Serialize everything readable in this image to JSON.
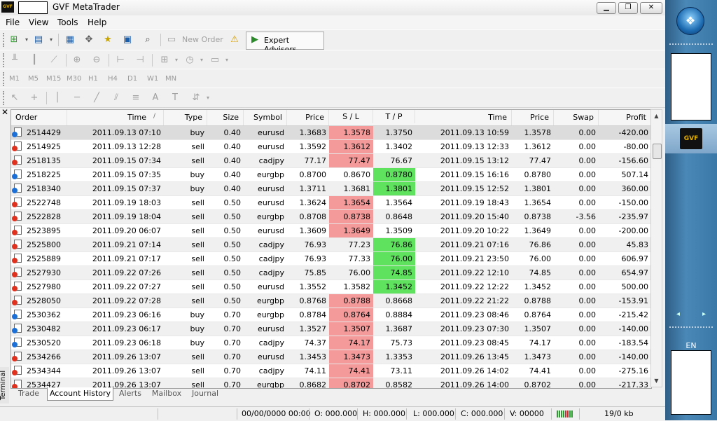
{
  "window": {
    "title": "GVF MetaTrader",
    "logo_text": "GVF"
  },
  "menu": [
    "File",
    "View",
    "Tools",
    "Help"
  ],
  "toolbar": {
    "new_order": "New Order",
    "expert_advisors": "Expert Advisors"
  },
  "timeframes": [
    "M1",
    "M5",
    "M15",
    "M30",
    "H1",
    "H4",
    "D1",
    "W1",
    "MN"
  ],
  "terminal": {
    "label": "Terminal",
    "columns": {
      "order": "Order",
      "open_time": "Time",
      "sort_indicator": "/",
      "type": "Type",
      "size": "Size",
      "symbol": "Symbol",
      "open_price": "Price",
      "sl": "S / L",
      "tp": "T / P",
      "close_time": "Time",
      "close_price": "Price",
      "swap": "Swap",
      "profit": "Profit"
    },
    "rows": [
      {
        "order": "2514429",
        "open_time": "2011.09.13 07:10",
        "type": "buy",
        "size": "0.40",
        "symbol": "eurusd",
        "open_price": "1.3683",
        "sl": "1.3578",
        "tp": "1.3750",
        "close_time": "2011.09.13 10:59",
        "close_price": "1.3578",
        "swap": "0.00",
        "profit": "-420.00",
        "hit": "sl"
      },
      {
        "order": "2514925",
        "open_time": "2011.09.13 12:28",
        "type": "sell",
        "size": "0.40",
        "symbol": "eurusd",
        "open_price": "1.3592",
        "sl": "1.3612",
        "tp": "1.3402",
        "close_time": "2011.09.13 12:33",
        "close_price": "1.3612",
        "swap": "0.00",
        "profit": "-80.00",
        "hit": "sl"
      },
      {
        "order": "2518135",
        "open_time": "2011.09.15 07:34",
        "type": "sell",
        "size": "0.40",
        "symbol": "cadjpy",
        "open_price": "77.17",
        "sl": "77.47",
        "tp": "76.67",
        "close_time": "2011.09.15 13:12",
        "close_price": "77.47",
        "swap": "0.00",
        "profit": "-156.60",
        "hit": "sl"
      },
      {
        "order": "2518225",
        "open_time": "2011.09.15 07:35",
        "type": "buy",
        "size": "0.40",
        "symbol": "eurgbp",
        "open_price": "0.8700",
        "sl": "0.8670",
        "tp": "0.8780",
        "close_time": "2011.09.15 16:16",
        "close_price": "0.8780",
        "swap": "0.00",
        "profit": "507.14",
        "hit": "tp"
      },
      {
        "order": "2518340",
        "open_time": "2011.09.15 07:37",
        "type": "buy",
        "size": "0.40",
        "symbol": "eurusd",
        "open_price": "1.3711",
        "sl": "1.3681",
        "tp": "1.3801",
        "close_time": "2011.09.15 12:52",
        "close_price": "1.3801",
        "swap": "0.00",
        "profit": "360.00",
        "hit": "tp"
      },
      {
        "order": "2522748",
        "open_time": "2011.09.19 18:03",
        "type": "sell",
        "size": "0.50",
        "symbol": "eurusd",
        "open_price": "1.3624",
        "sl": "1.3654",
        "tp": "1.3564",
        "close_time": "2011.09.19 18:43",
        "close_price": "1.3654",
        "swap": "0.00",
        "profit": "-150.00",
        "hit": "sl"
      },
      {
        "order": "2522828",
        "open_time": "2011.09.19 18:04",
        "type": "sell",
        "size": "0.50",
        "symbol": "eurgbp",
        "open_price": "0.8708",
        "sl": "0.8738",
        "tp": "0.8648",
        "close_time": "2011.09.20 15:40",
        "close_price": "0.8738",
        "swap": "-3.56",
        "profit": "-235.97",
        "hit": "sl"
      },
      {
        "order": "2523895",
        "open_time": "2011.09.20 06:07",
        "type": "sell",
        "size": "0.50",
        "symbol": "eurusd",
        "open_price": "1.3609",
        "sl": "1.3649",
        "tp": "1.3509",
        "close_time": "2011.09.20 10:22",
        "close_price": "1.3649",
        "swap": "0.00",
        "profit": "-200.00",
        "hit": "sl"
      },
      {
        "order": "2525800",
        "open_time": "2011.09.21 07:14",
        "type": "sell",
        "size": "0.50",
        "symbol": "cadjpy",
        "open_price": "76.93",
        "sl": "77.23",
        "tp": "76.86",
        "close_time": "2011.09.21 07:16",
        "close_price": "76.86",
        "swap": "0.00",
        "profit": "45.83",
        "hit": "tp"
      },
      {
        "order": "2525889",
        "open_time": "2011.09.21 07:17",
        "type": "sell",
        "size": "0.50",
        "symbol": "cadjpy",
        "open_price": "76.93",
        "sl": "77.33",
        "tp": "76.00",
        "close_time": "2011.09.21 23:50",
        "close_price": "76.00",
        "swap": "0.00",
        "profit": "606.97",
        "hit": "tp"
      },
      {
        "order": "2527930",
        "open_time": "2011.09.22 07:26",
        "type": "sell",
        "size": "0.50",
        "symbol": "cadjpy",
        "open_price": "75.85",
        "sl": "76.00",
        "tp": "74.85",
        "close_time": "2011.09.22 12:10",
        "close_price": "74.85",
        "swap": "0.00",
        "profit": "654.97",
        "hit": "tp"
      },
      {
        "order": "2527980",
        "open_time": "2011.09.22 07:27",
        "type": "sell",
        "size": "0.50",
        "symbol": "eurusd",
        "open_price": "1.3552",
        "sl": "1.3582",
        "tp": "1.3452",
        "close_time": "2011.09.22 12:22",
        "close_price": "1.3452",
        "swap": "0.00",
        "profit": "500.00",
        "hit": "tp"
      },
      {
        "order": "2528050",
        "open_time": "2011.09.22 07:28",
        "type": "sell",
        "size": "0.50",
        "symbol": "eurgbp",
        "open_price": "0.8768",
        "sl": "0.8788",
        "tp": "0.8668",
        "close_time": "2011.09.22 21:22",
        "close_price": "0.8788",
        "swap": "0.00",
        "profit": "-153.91",
        "hit": "sl"
      },
      {
        "order": "2530362",
        "open_time": "2011.09.23 06:16",
        "type": "buy",
        "size": "0.70",
        "symbol": "eurgbp",
        "open_price": "0.8784",
        "sl": "0.8764",
        "tp": "0.8884",
        "close_time": "2011.09.23 08:46",
        "close_price": "0.8764",
        "swap": "0.00",
        "profit": "-215.42",
        "hit": "sl"
      },
      {
        "order": "2530482",
        "open_time": "2011.09.23 06:17",
        "type": "buy",
        "size": "0.70",
        "symbol": "eurusd",
        "open_price": "1.3527",
        "sl": "1.3507",
        "tp": "1.3687",
        "close_time": "2011.09.23 07:30",
        "close_price": "1.3507",
        "swap": "0.00",
        "profit": "-140.00",
        "hit": "sl"
      },
      {
        "order": "2530520",
        "open_time": "2011.09.23 06:18",
        "type": "buy",
        "size": "0.70",
        "symbol": "cadjpy",
        "open_price": "74.37",
        "sl": "74.17",
        "tp": "75.73",
        "close_time": "2011.09.23 08:45",
        "close_price": "74.17",
        "swap": "0.00",
        "profit": "-183.54",
        "hit": "sl"
      },
      {
        "order": "2534266",
        "open_time": "2011.09.26 13:07",
        "type": "sell",
        "size": "0.70",
        "symbol": "eurusd",
        "open_price": "1.3453",
        "sl": "1.3473",
        "tp": "1.3353",
        "close_time": "2011.09.26 13:45",
        "close_price": "1.3473",
        "swap": "0.00",
        "profit": "-140.00",
        "hit": "sl"
      },
      {
        "order": "2534344",
        "open_time": "2011.09.26 13:07",
        "type": "sell",
        "size": "0.70",
        "symbol": "cadjpy",
        "open_price": "74.11",
        "sl": "74.41",
        "tp": "73.11",
        "close_time": "2011.09.26 14:02",
        "close_price": "74.41",
        "swap": "0.00",
        "profit": "-275.16",
        "hit": "sl"
      },
      {
        "order": "2534427",
        "open_time": "2011.09.26 13:07",
        "type": "sell",
        "size": "0.70",
        "symbol": "eurgbp",
        "open_price": "0.8682",
        "sl": "0.8702",
        "tp": "0.8582",
        "close_time": "2011.09.26 14:00",
        "close_price": "0.8702",
        "swap": "0.00",
        "profit": "-217.33",
        "hit": "sl"
      }
    ],
    "tabs": [
      "Trade",
      "Account History",
      "Alerts",
      "Mailbox",
      "Journal"
    ],
    "active_tab": "Account History"
  },
  "statusbar": {
    "datetime": "00/00/0000 00:00",
    "open": "O: 000.000",
    "high": "H: 000.000",
    "low": "L: 000.000",
    "close": "C: 000.000",
    "volume": "V: 00000",
    "traffic": "19/0 kb"
  },
  "taskbar": {
    "language": "EN",
    "app_label": "GVF"
  },
  "colors": {
    "sl_hit": "#f49a9a",
    "tp_hit": "#5fe35f",
    "buy_dot": "#1b6fd6",
    "sell_dot": "#e0301e",
    "taskbar": "#3a78a8"
  }
}
